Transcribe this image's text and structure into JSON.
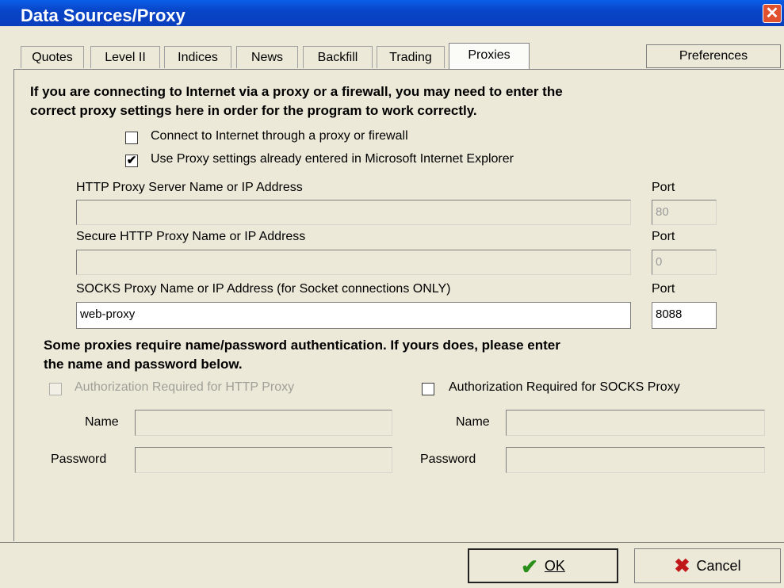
{
  "window": {
    "title": "Data Sources/Proxy",
    "close_symbol": "✕"
  },
  "tabs": [
    {
      "label": "Quotes"
    },
    {
      "label": "Level II"
    },
    {
      "label": "Indices"
    },
    {
      "label": "News"
    },
    {
      "label": "Backfill"
    },
    {
      "label": "Trading"
    },
    {
      "label": "Proxies"
    }
  ],
  "preferences_label": "Preferences",
  "intro_line1": "If you are connecting to Internet via a proxy or a firewall, you may need to enter the",
  "intro_line2": "correct proxy settings here in order for the program to work correctly.",
  "connect_cb": {
    "label": "Connect to Internet through a proxy or firewall",
    "checked": false
  },
  "ie_cb": {
    "label": "Use Proxy settings already entered in Microsoft Internet Explorer",
    "checked": true,
    "mark": "✔"
  },
  "http": {
    "label": "HTTP Proxy Server Name or IP Address",
    "value": "",
    "port_label": "Port",
    "port": "80"
  },
  "secure": {
    "label": "Secure HTTP Proxy Name or IP Address",
    "value": "",
    "port_label": "Port",
    "port": "0"
  },
  "socks": {
    "label": "SOCKS Proxy Name or IP Address (for Socket connections ONLY)",
    "value": "web-proxy",
    "port_label": "Port",
    "port": "8088"
  },
  "auth_line1": "Some proxies require name/password authentication. If yours does, please enter",
  "auth_line2": "the name and password below.",
  "http_auth": {
    "label": "Authorization Required for HTTP Proxy",
    "name_label": "Name",
    "password_label": "Password",
    "name": "",
    "password": ""
  },
  "socks_auth": {
    "label": "Authorization Required for SOCKS Proxy",
    "name_label": "Name",
    "password_label": "Password",
    "name": "",
    "password": ""
  },
  "ok": {
    "label": "OK",
    "icon": "✔"
  },
  "cancel": {
    "label": "Cancel",
    "icon": "✖"
  }
}
